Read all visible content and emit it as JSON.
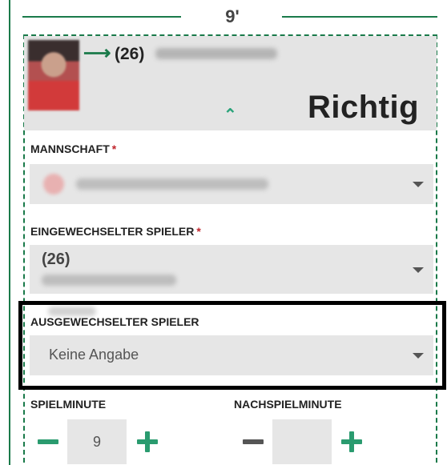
{
  "minute_label": "9'",
  "header": {
    "player_number": "(26)",
    "status_text": "Richtig"
  },
  "fields": {
    "team": {
      "label": "MANNSCHAFT",
      "required_mark": "*"
    },
    "player_in": {
      "label": "EINGEWECHSELTER SPIELER",
      "required_mark": "*",
      "number": "(26)"
    },
    "player_out": {
      "label": "AUSGEWECHSELTER SPIELER",
      "value": "Keine Angabe"
    },
    "minute": {
      "label": "SPIELMINUTE",
      "value": "9"
    },
    "extra_minute": {
      "label": "NACHSPIELMINUTE",
      "value": ""
    }
  },
  "colors": {
    "accent_green": "#1a7a4a",
    "plus_green": "#2a9b6f",
    "required_red": "#c0262d",
    "minus_active": "#2a9b6f",
    "minus_inactive": "#555555"
  },
  "icons": {
    "arrow": "right-arrow-icon",
    "collapse": "chevron-up-icon",
    "dropdown": "chevron-down-icon",
    "decrement": "minus-icon",
    "increment": "plus-icon"
  }
}
